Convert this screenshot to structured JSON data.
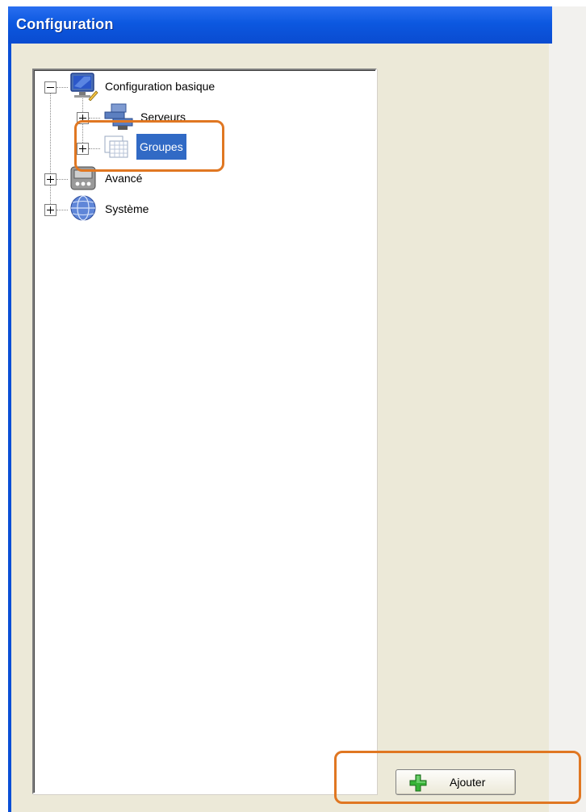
{
  "window": {
    "title": "Configuration"
  },
  "tree": {
    "items": [
      {
        "label": "Configuration basique",
        "icon": "computer-monitor-icon",
        "expanded": true
      },
      {
        "label": "Serveurs",
        "icon": "servers-icon",
        "expanded": false
      },
      {
        "label": "Groupes",
        "icon": "groups-grid-icon",
        "expanded": false,
        "selected": true
      },
      {
        "label": "Avancé",
        "icon": "advanced-panel-icon",
        "expanded": false
      },
      {
        "label": "Système",
        "icon": "globe-icon",
        "expanded": false
      }
    ]
  },
  "actions": {
    "add_label": "Ajouter",
    "add_icon": "green-plus-icon"
  },
  "colors": {
    "titlebar": "#0c58e0",
    "window_bg": "#ece9d8",
    "selection": "#316ac5",
    "highlight": "#e07722"
  }
}
